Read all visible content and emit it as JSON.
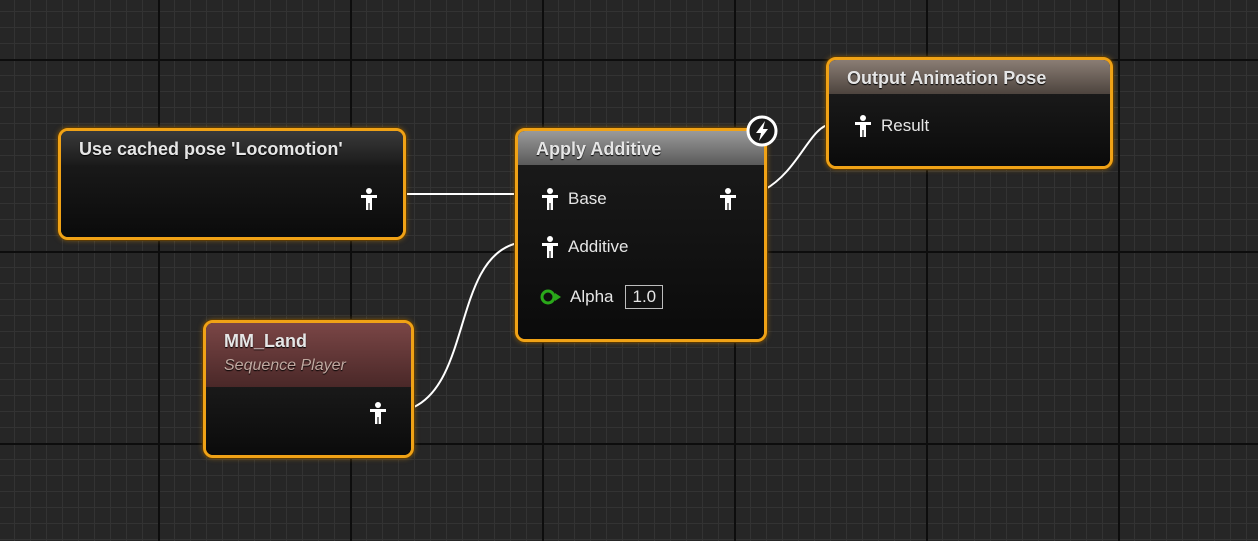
{
  "graph": {
    "nodes": {
      "cached_pose": {
        "title": "Use cached pose 'Locomotion'"
      },
      "sequence_player": {
        "title": "MM_Land",
        "subtitle": "Sequence Player"
      },
      "apply_additive": {
        "title": "Apply Additive",
        "pins": {
          "base": "Base",
          "additive": "Additive",
          "alpha": "Alpha"
        },
        "alpha_value": "1.0"
      },
      "output_pose": {
        "title": "Output Animation Pose",
        "pins": {
          "result": "Result"
        }
      }
    },
    "icons": {
      "pose_pin": "pose-person-icon",
      "float_pin": "float-pin-icon",
      "fast_path": "lightning-bolt-icon"
    },
    "colors": {
      "node_border": "#f0a216",
      "wire": "#ffffff",
      "float_pin": "#2aa81a",
      "sequence_header": "#6e3b3b",
      "apply_header": "#8c8c8c",
      "output_header": "#7a6e66"
    }
  }
}
